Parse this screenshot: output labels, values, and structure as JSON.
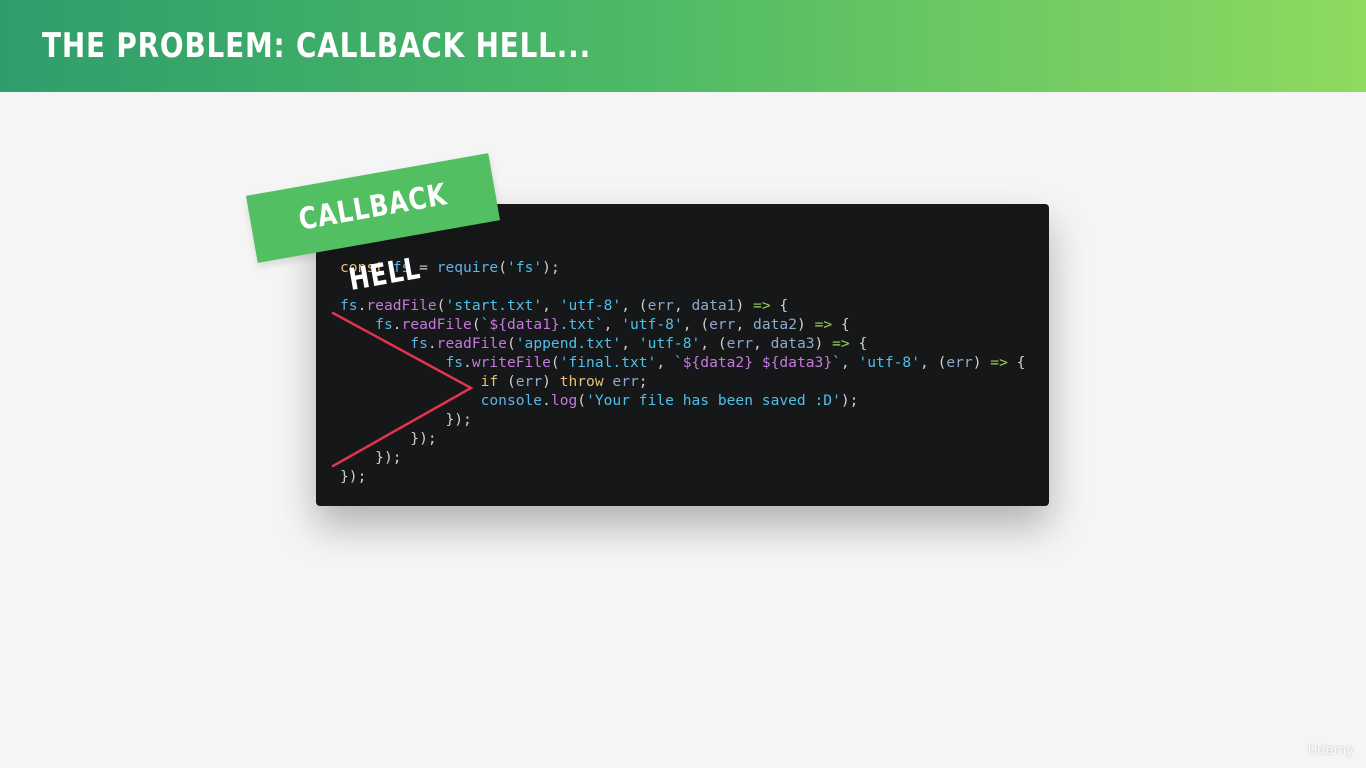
{
  "slide": {
    "title": "THE PROBLEM: CALLBACK HELL...",
    "tag_label": "CALLBACK HELL",
    "watermark": "Udemy"
  },
  "code": {
    "lines": [
      "const fs = require('fs');",
      "",
      "fs.readFile('start.txt', 'utf-8', (err, data1) => {",
      "    fs.readFile(`${data1}.txt`, 'utf-8', (err, data2) => {",
      "        fs.readFile('append.txt', 'utf-8', (err, data3) => {",
      "            fs.writeFile('final.txt', `${data2} ${data3}`, 'utf-8', (err) => {",
      "                if (err) throw err;",
      "                console.log('Your file has been saved :D');",
      "            });",
      "        });",
      "    });",
      "});"
    ]
  },
  "colors": {
    "header_gradient_start": "#2e9e6c",
    "header_gradient_end": "#8fda60",
    "tag_background": "#52bf62",
    "code_background": "#161718",
    "callback_pyramid_line": "#e0344f"
  }
}
